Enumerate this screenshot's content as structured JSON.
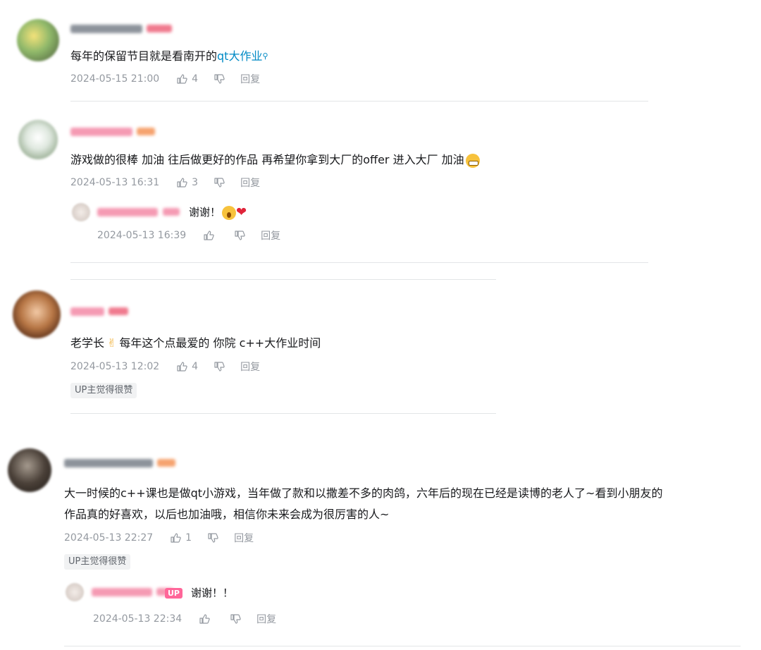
{
  "comments": [
    {
      "text_plain": "每年的保留节目就是看南开的",
      "text_link": "qt大作业",
      "time": "2024-05-15 21:00",
      "likes": "4",
      "reply_label": "回复"
    },
    {
      "text": "游戏做的很棒 加油 往后做更好的作品 再希望你拿到大厂的offer 进入大厂 加油",
      "time": "2024-05-13 16:31",
      "likes": "3",
      "reply_label": "回复",
      "reply": {
        "text": "谢谢！",
        "time": "2024-05-13 16:39",
        "reply_label": "回复"
      }
    },
    {
      "text": "老学长",
      "text_rest": "每年这个点最爱的 你院 c++大作业时间",
      "time": "2024-05-13 12:02",
      "likes": "4",
      "reply_label": "回复",
      "up_liked": "UP主觉得很赞"
    },
    {
      "text_line1": "大一时候的c++课也是做qt小游戏，当年做了款和以撒差不多的肉鸽，六年后的现在已经是读博的老人了~看到小朋友的",
      "text_line2": "作品真的好喜欢，以后也加油哦，相信你未来会成为很厉害的人~",
      "time": "2024-05-13 22:27",
      "likes": "1",
      "reply_label": "回复",
      "up_liked": "UP主觉得很赞",
      "reply": {
        "up_badge": "UP",
        "text": "谢谢！！",
        "time": "2024-05-13 22:34",
        "reply_label": "回复"
      }
    }
  ],
  "icons": {
    "like": "thumb-up-icon",
    "dislike": "thumb-down-icon",
    "search": "search-icon"
  },
  "colors": {
    "link": "#008ac5",
    "meta": "#9499a0",
    "up_badge": "#ff6699"
  }
}
